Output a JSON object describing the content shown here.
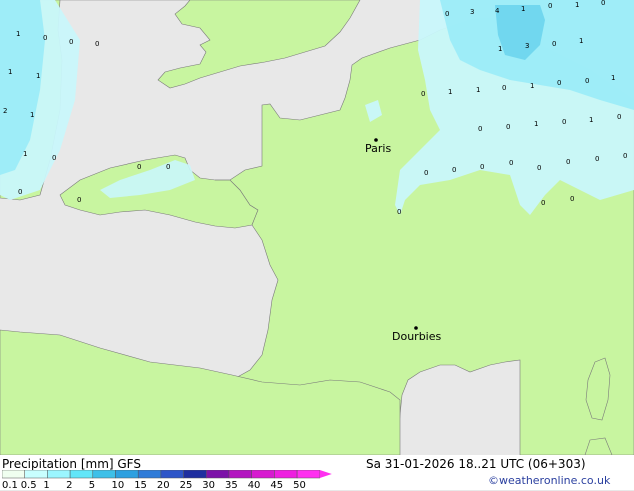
{
  "map": {
    "cities": [
      {
        "name": "Paris"
      },
      {
        "name": "Dourbies"
      }
    ],
    "precip_values": [
      "1",
      "0",
      "1",
      "0",
      "1",
      "2",
      "1",
      "1",
      "0",
      "0",
      "0",
      "0",
      "0",
      "0",
      "0",
      "0",
      "0",
      "0",
      "0",
      "0",
      "0",
      "0",
      "0",
      "0",
      "0",
      "0",
      "3",
      "4",
      "1",
      "0",
      "1",
      "0",
      "1",
      "3",
      "0",
      "1",
      "1",
      "1",
      "0",
      "1",
      "0",
      "0",
      "1",
      "0",
      "0",
      "0",
      "1",
      "0",
      "1",
      "0"
    ]
  },
  "footer": {
    "title": "Precipitation [mm] GFS",
    "datetime": "Sa 31-01-2026 18..21 UTC (06+303)",
    "credit": "©weatheronline.co.uk"
  },
  "legend": {
    "labels": [
      "0.1",
      "0.5",
      "1",
      "2",
      "5",
      "10",
      "15",
      "20",
      "25",
      "30",
      "35",
      "40",
      "45",
      "50"
    ],
    "colors": [
      "#f0fff0",
      "#c8ffff",
      "#9bf6ff",
      "#62e6f8",
      "#3ec0e8",
      "#2da0e0",
      "#2f7bd8",
      "#2d55c8",
      "#1e2e9f",
      "#7c12a8",
      "#b315c0",
      "#d71ad0",
      "#ee1fe0",
      "#ff30f0"
    ]
  },
  "colors": {
    "land": "#c8f5a0",
    "sea": "#e8e8e8",
    "precip_light": "#c9f7fb",
    "precip_medium": "#9cecf8",
    "precip_heavy": "#6fd6ee"
  }
}
